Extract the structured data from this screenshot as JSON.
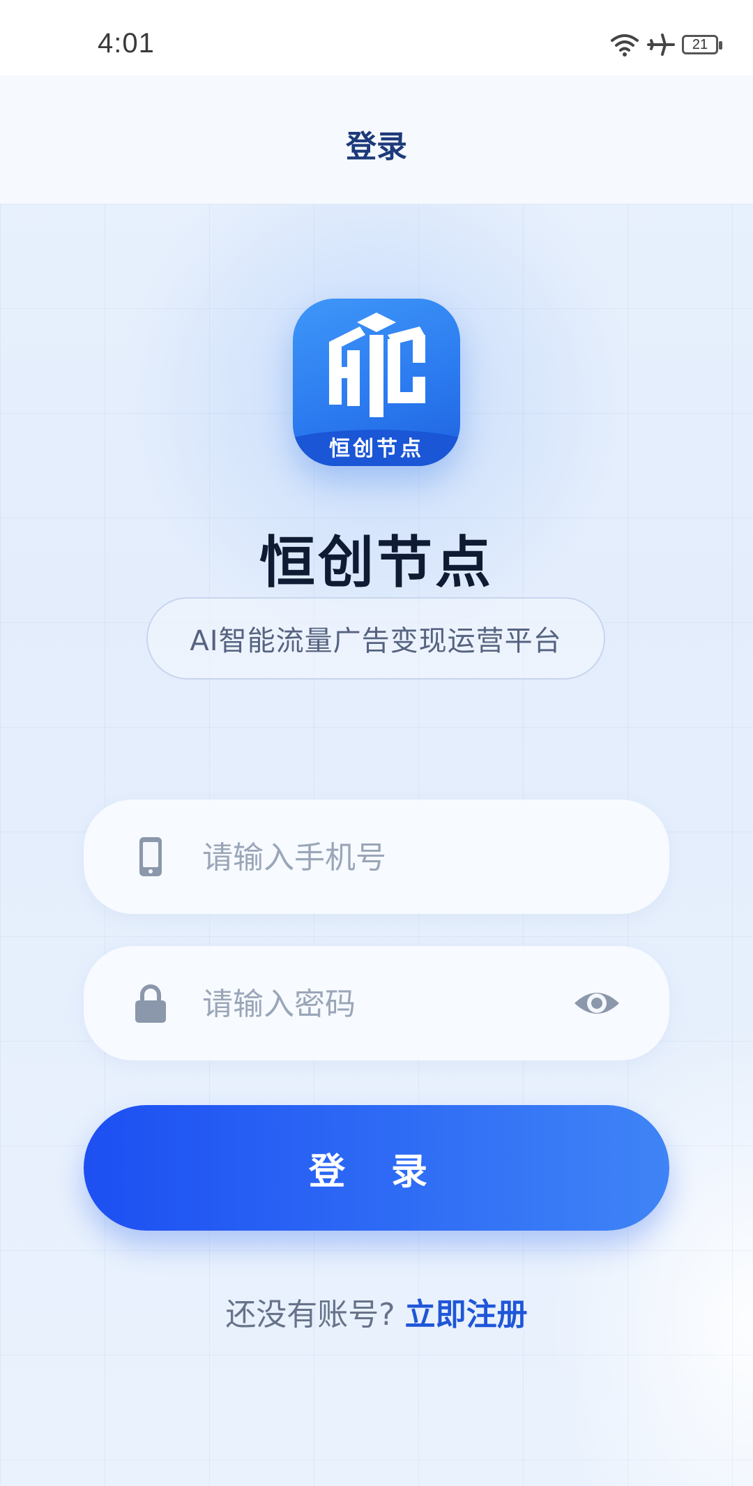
{
  "status_bar": {
    "time": "4:01",
    "battery": "21",
    "icons": [
      "wifi-icon",
      "airplane-icon",
      "battery-icon"
    ]
  },
  "header": {
    "title": "登录"
  },
  "logo": {
    "label": "恒创节点",
    "mark": "HYC"
  },
  "app": {
    "name": "恒创节点",
    "tagline": "AI智能流量广告变现运营平台"
  },
  "form": {
    "phone": {
      "value": "",
      "placeholder": "请输入手机号",
      "icon": "phone-icon"
    },
    "password": {
      "value": "",
      "placeholder": "请输入密码",
      "icon": "lock-icon",
      "toggle_icon": "eye-icon"
    },
    "login_label": "登 录"
  },
  "register": {
    "prompt": "还没有账号?",
    "link": "立即注册"
  },
  "colors": {
    "primary": "#2563f0",
    "title": "#0f1b33",
    "link": "#1f56d8",
    "placeholder": "#9aa6b8"
  }
}
